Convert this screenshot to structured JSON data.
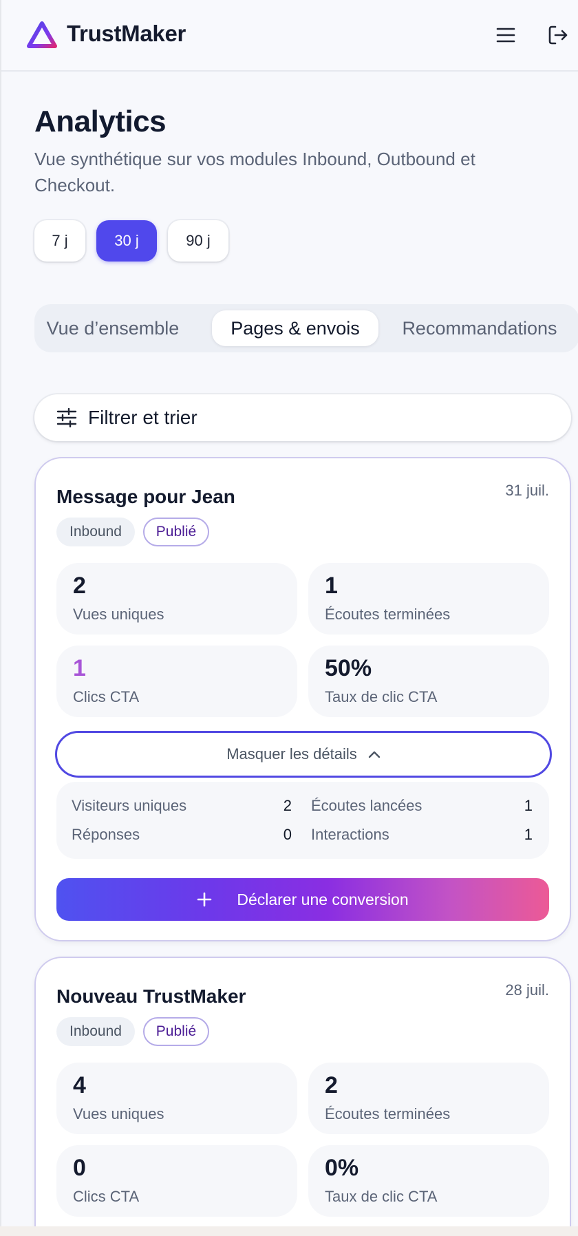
{
  "app": {
    "brand": "TrustMaker",
    "colors": {
      "accent": "#5048ec",
      "cta_start": "#4f52f0",
      "cta_end": "#ec5a96",
      "cta_click_value": "#a855d7"
    }
  },
  "header": {
    "icons": {
      "menu": "hamburger-menu-icon",
      "logout": "logout-icon"
    }
  },
  "page": {
    "title": "Analytics",
    "subtitle": "Vue synthétique sur vos modules Inbound, Outbound et Checkout."
  },
  "ranges": {
    "items": [
      {
        "label": "7 j",
        "active": false
      },
      {
        "label": "30 j",
        "active": true
      },
      {
        "label": "90 j",
        "active": false
      }
    ]
  },
  "tabs": {
    "items": [
      {
        "label": "Vue d’ensemble",
        "active": false
      },
      {
        "label": "Pages & envois",
        "active": true
      },
      {
        "label": "Recommandations",
        "active": false
      }
    ]
  },
  "filter": {
    "label": "Filtrer et trier",
    "icon": "sliders-icon"
  },
  "cards": [
    {
      "title": "Message pour Jean",
      "date": "31 juil.",
      "source_tag": "Inbound",
      "status_tag": "Publié",
      "metrics": [
        {
          "value": "2",
          "label": "Vues uniques"
        },
        {
          "value": "1",
          "label": "Écoutes terminées"
        },
        {
          "value": "1",
          "label": "Clics CTA"
        },
        {
          "value": "50%",
          "label": "Taux de clic CTA"
        }
      ],
      "details_toggle": "Masquer les détails",
      "details": [
        {
          "label": "Visiteurs uniques",
          "value": "2"
        },
        {
          "label": "Écoutes lancées",
          "value": "1"
        },
        {
          "label": "Réponses",
          "value": "0"
        },
        {
          "label": "Interactions",
          "value": "1"
        }
      ],
      "conversion_button": "Déclarer une conversion"
    },
    {
      "title": "Nouveau TrustMaker",
      "date": "28 juil.",
      "source_tag": "Inbound",
      "status_tag": "Publié",
      "metrics": [
        {
          "value": "4",
          "label": "Vues uniques"
        },
        {
          "value": "2",
          "label": "Écoutes terminées"
        },
        {
          "value": "0",
          "label": "Clics CTA"
        },
        {
          "value": "0%",
          "label": "Taux de clic CTA"
        }
      ]
    }
  ]
}
